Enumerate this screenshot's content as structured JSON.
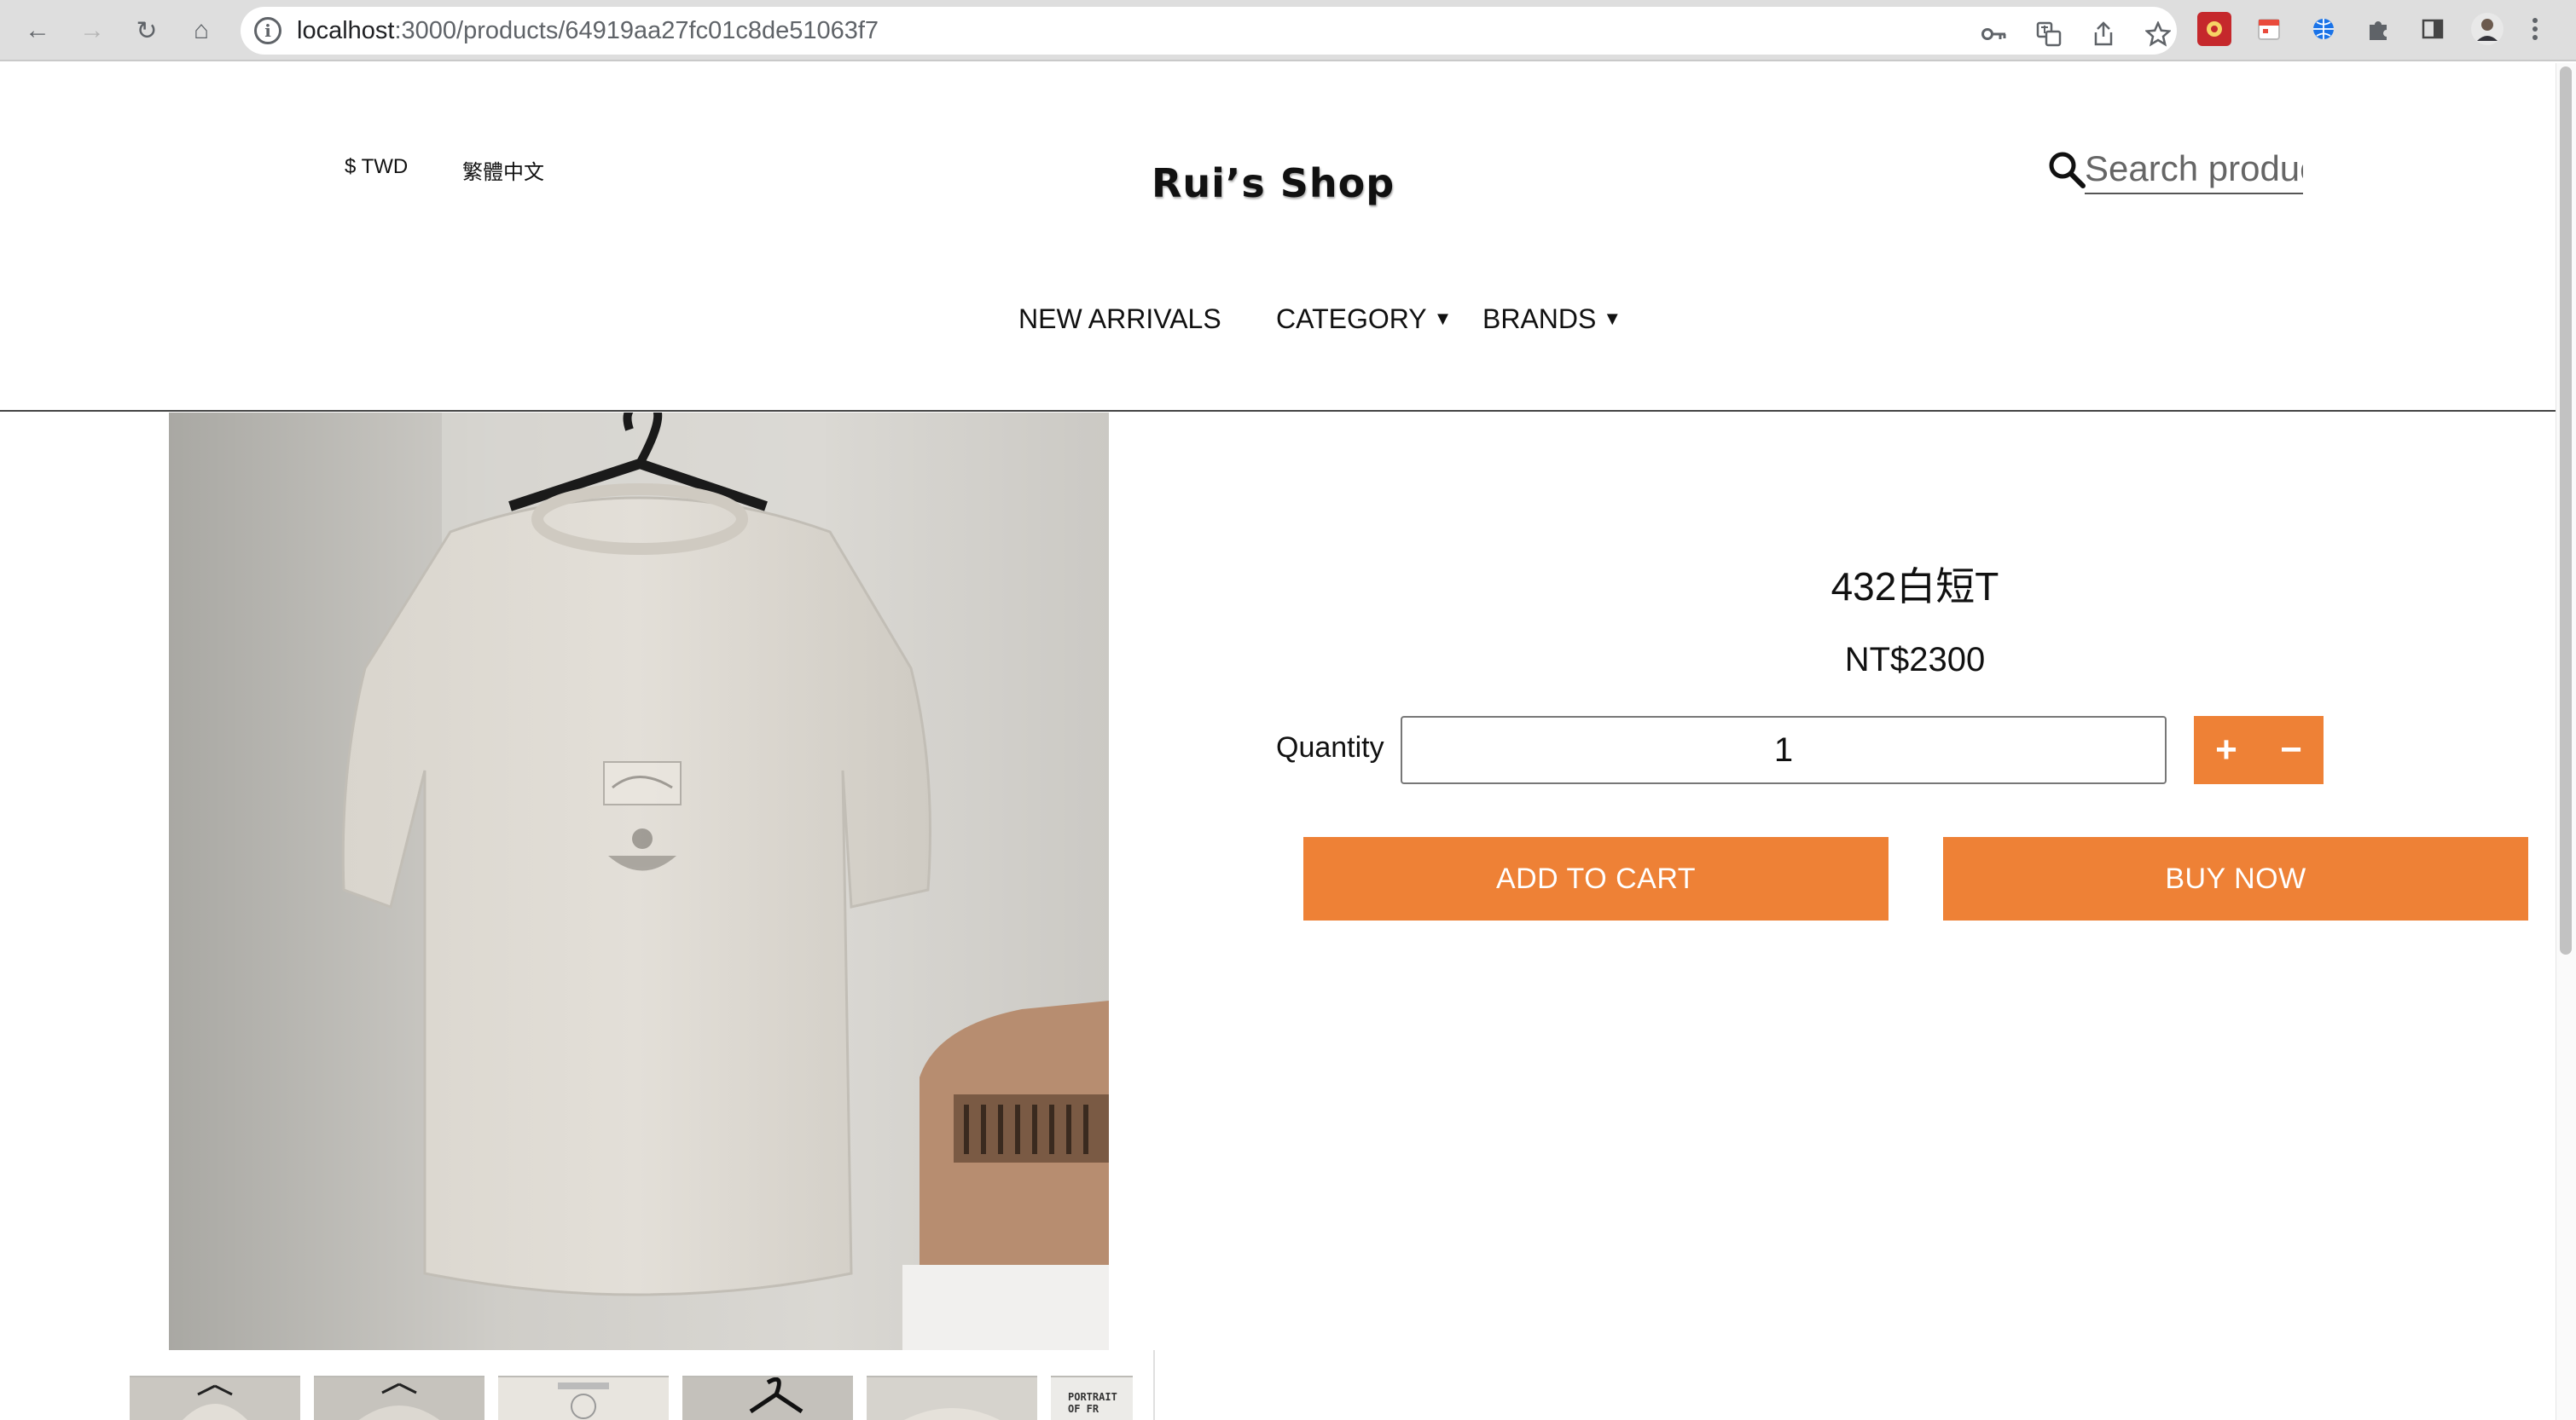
{
  "browser": {
    "url_host": "localhost",
    "url_path": ":3000/products/64919aa27fc01c8de51063f7",
    "back_icon": "←",
    "forward_icon": "→",
    "reload_icon": "↻",
    "home_icon": "⌂",
    "info_icon": "i"
  },
  "header": {
    "currency": "$ TWD",
    "language": "繁體中文",
    "brand": "Rui’s Shop",
    "search_placeholder": "Search products"
  },
  "nav": {
    "new_arrivals": "NEW ARRIVALS",
    "category": "CATEGORY",
    "brands": "BRANDS",
    "caret": "▼"
  },
  "product": {
    "title": "432白短T",
    "price": "NT$2300",
    "quantity_label": "Quantity",
    "quantity_value": "1",
    "plus": "+",
    "minus": "−",
    "add_to_cart": "ADD TO CART",
    "buy_now": "BUY NOW",
    "thumb_text": "PORTRAIT OF FR"
  },
  "colors": {
    "accent": "#ee8136"
  }
}
